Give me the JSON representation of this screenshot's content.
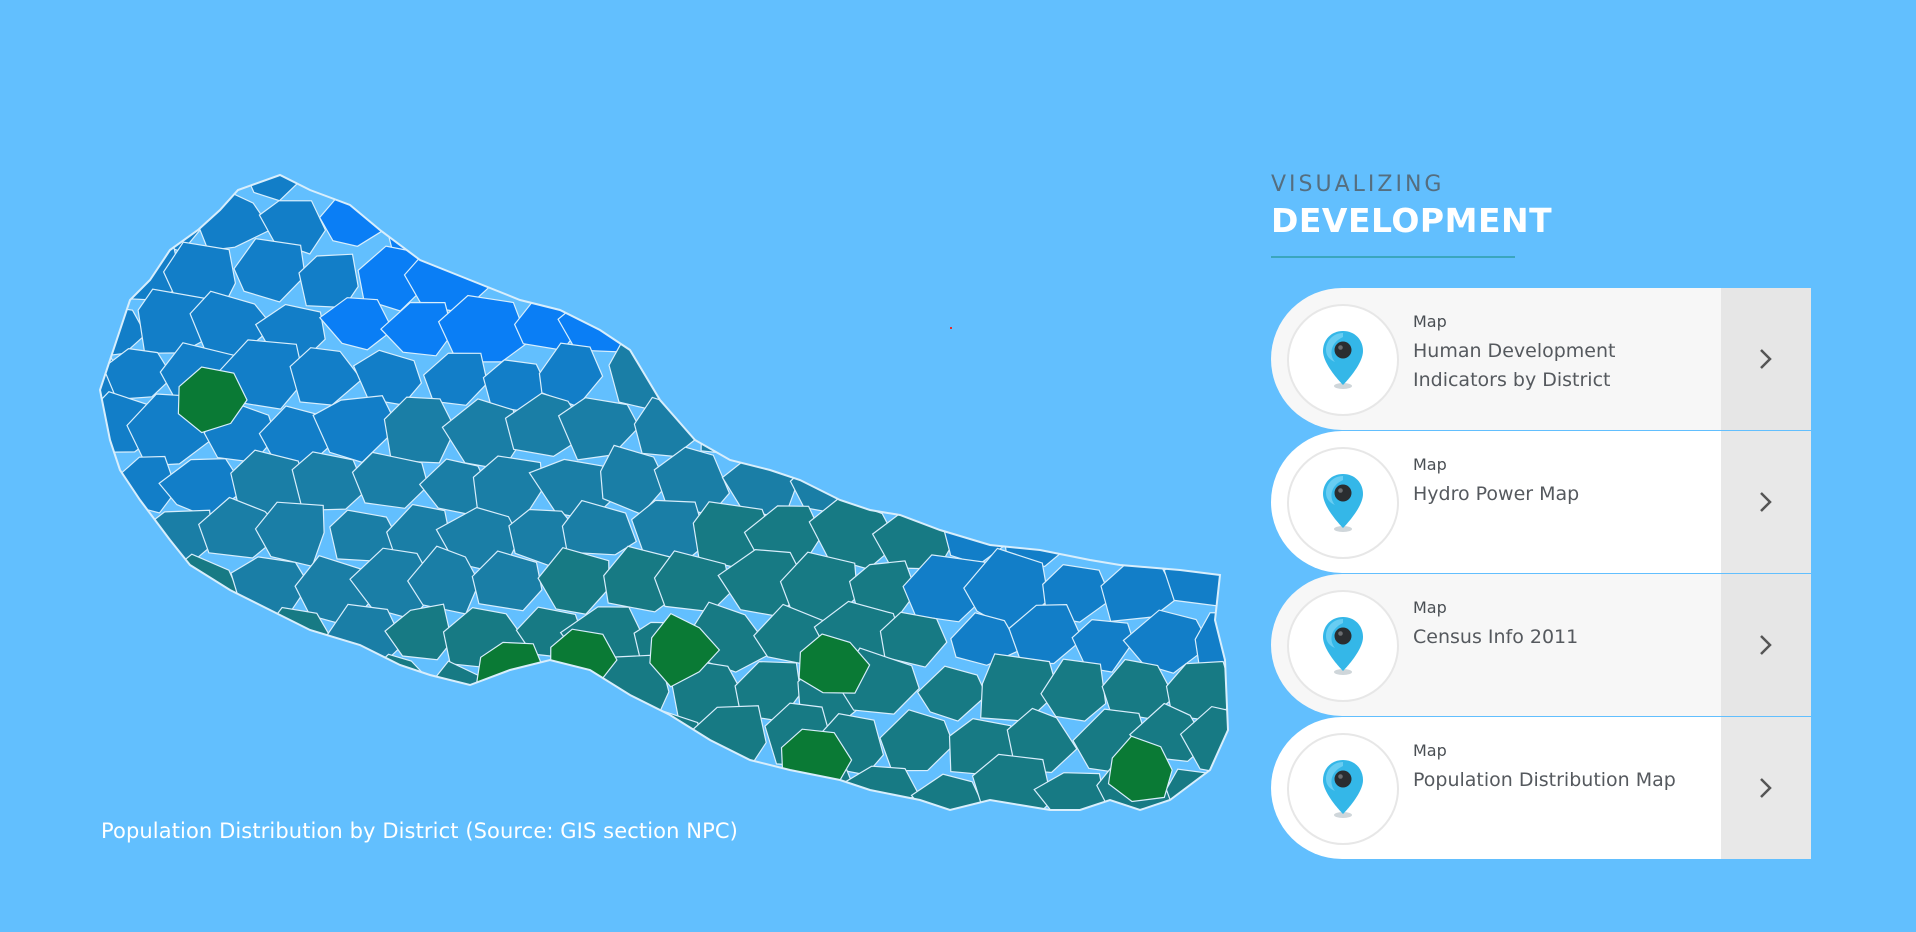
{
  "map": {
    "caption": "Population Distribution by District (Source: GIS section NPC)",
    "colors": {
      "background": "#62bffe",
      "high_altitude": "#0a7ef5",
      "mid_blue": "#127ec8",
      "steel": "#1a7ea6",
      "teal": "#177a84",
      "sea_green": "#11806a",
      "dense_green": "#0a7a35",
      "border": "#d8eefc"
    }
  },
  "heading": {
    "kicker": "VISUALIZING",
    "title": "DEVELOPMENT"
  },
  "cards": [
    {
      "kind": "Map",
      "name": "Human Development Indicators by District",
      "icon": "map-pin-icon",
      "arrow": "chevron-right-icon"
    },
    {
      "kind": "Map",
      "name": "Hydro Power Map",
      "icon": "map-pin-icon",
      "arrow": "chevron-right-icon"
    },
    {
      "kind": "Map",
      "name": "Census Info 2011",
      "icon": "map-pin-icon",
      "arrow": "chevron-right-icon"
    },
    {
      "kind": "Map",
      "name": "Population Distribution Map",
      "icon": "map-pin-icon",
      "arrow": "chevron-right-icon"
    }
  ]
}
